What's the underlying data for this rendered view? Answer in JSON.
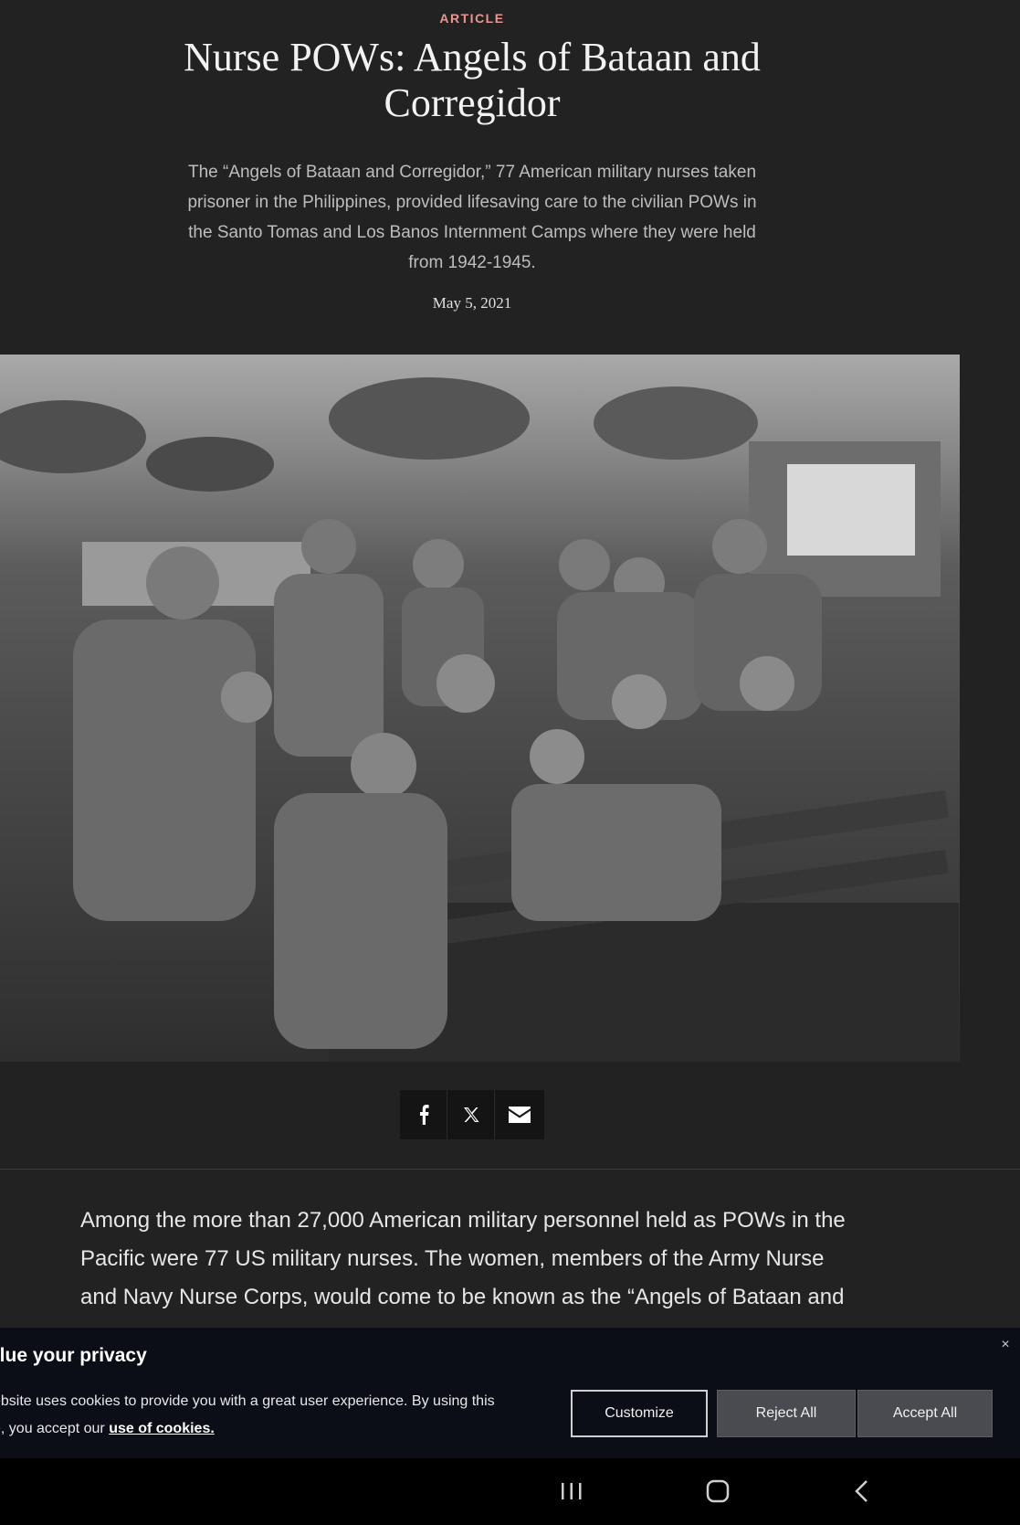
{
  "article": {
    "eyebrow": "ARTICLE",
    "title": "Nurse POWs: Angels of Bataan and Corregidor",
    "summary": "The “Angels of Bataan and Corregidor,” 77 American military nurses taken prisoner in the Philippines, provided lifesaving care to the civilian POWs in the Santo Tomas and Los Banos Internment Camps where they were held from 1942-1945.",
    "date": "May 5, 2021",
    "body": "Among the more than 27,000 American military personnel held as POWs in the Pacific were 77 US military nurses. The women, members of the Army Nurse and Navy Nurse Corps, would come to be known as the “Angels of Bataan and"
  },
  "share": {
    "icons": [
      "facebook-icon",
      "x-icon",
      "email-icon"
    ]
  },
  "cookie": {
    "title": "alue your privacy",
    "message_line1": "ebsite uses cookies to provide you with a great user experience. By using this",
    "message_line2_prefix": "e, you accept our ",
    "link": "use of cookies.",
    "customize": "Customize",
    "reject": "Reject All",
    "accept": "Accept All",
    "close": "×"
  },
  "colors": {
    "background": "#222223",
    "eyebrow": "#e8968e",
    "banner": "#0b0d17",
    "button_gray": "#4a4b50"
  }
}
